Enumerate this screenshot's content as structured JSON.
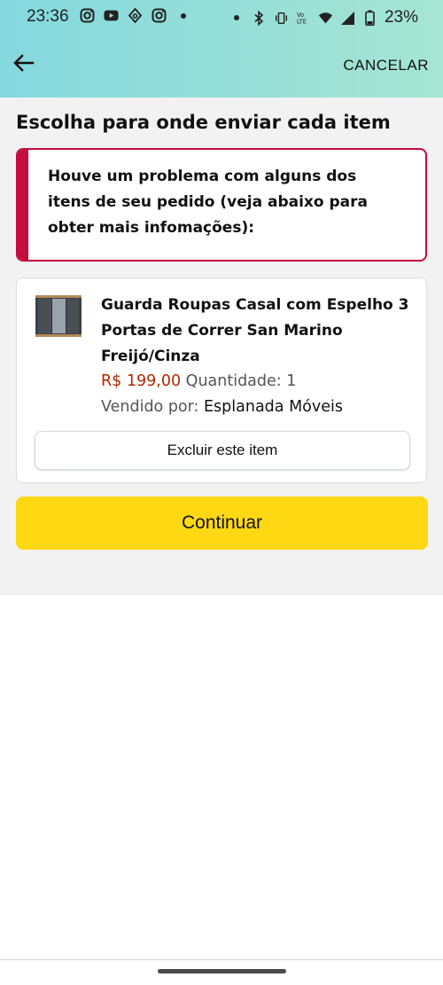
{
  "status_bar": {
    "time": "23:36",
    "battery": "23%",
    "left_icons": [
      "instagram-icon",
      "youtube-icon",
      "location-icon",
      "instagram-icon",
      "dot-icon"
    ],
    "right_icons": [
      "dot-icon",
      "bluetooth-icon",
      "vibrate-icon",
      "volte-icon",
      "wifi-icon",
      "signal-icon",
      "battery-icon"
    ]
  },
  "header": {
    "back_icon": "arrow-left-icon",
    "cancel_label": "CANCELAR"
  },
  "page": {
    "title": "Escolha para onde enviar cada item"
  },
  "alert": {
    "message": "Houve um problema com alguns dos itens de seu pedido (veja abaixo para obter mais infomações):"
  },
  "item": {
    "title": "Guarda Roupas Casal com Espelho 3 Portas de Correr San Marino Freijó/Cinza",
    "price": "R$ 199,00",
    "quantity": "Quantidade: 1",
    "sold_by_label": "Vendido por:",
    "seller": "Esplanada Móveis",
    "delete_label": "Excluir este item"
  },
  "actions": {
    "continue_label": "Continuar"
  },
  "colors": {
    "header_gradient_start": "#84d8de",
    "header_gradient_end": "#a6e5d2",
    "alert_red": "#c40d3d",
    "price_red": "#b12704",
    "continue_yellow": "#ffd814",
    "content_bg": "#f2f2f2"
  }
}
